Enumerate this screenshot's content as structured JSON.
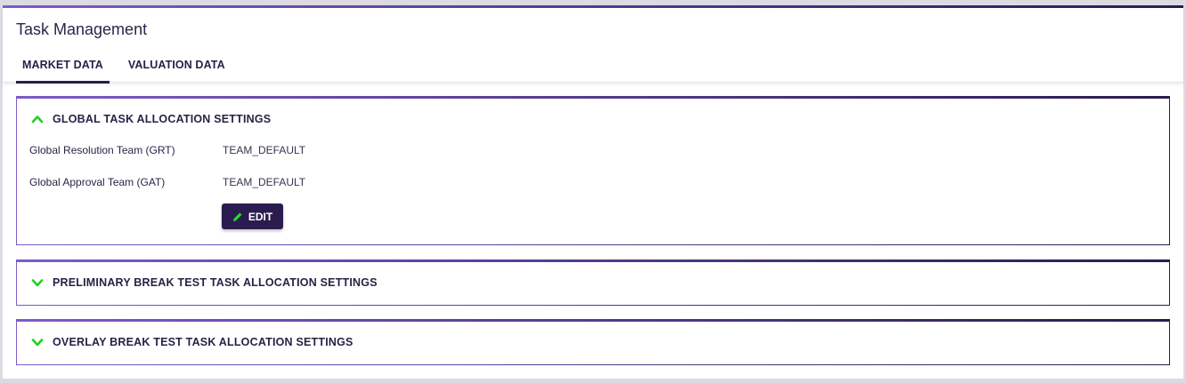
{
  "page": {
    "title": "Task Management"
  },
  "tabs": [
    {
      "label": "MARKET DATA",
      "active": true
    },
    {
      "label": "VALUATION DATA",
      "active": false
    }
  ],
  "panels": {
    "global": {
      "title": "GLOBAL TASK ALLOCATION SETTINGS",
      "expanded": true,
      "rows": [
        {
          "label": "Global Resolution Team (GRT)",
          "value": "TEAM_DEFAULT"
        },
        {
          "label": "Global Approval Team (GAT)",
          "value": "TEAM_DEFAULT"
        }
      ],
      "edit_label": "EDIT"
    },
    "preliminary": {
      "title": "PRELIMINARY BREAK TEST TASK ALLOCATION SETTINGS",
      "expanded": false
    },
    "overlay": {
      "title": "OVERLAY BREAK TEST TASK ALLOCATION SETTINGS",
      "expanded": false
    }
  },
  "colors": {
    "accent_dark": "#2b1c4f",
    "accent_light": "#7b5cc8",
    "chevron": "#1fd11f",
    "pencil": "#22e02a"
  },
  "icons": {
    "collapse": "chevron-up-icon",
    "expand": "chevron-down-icon",
    "edit": "pencil-icon"
  }
}
